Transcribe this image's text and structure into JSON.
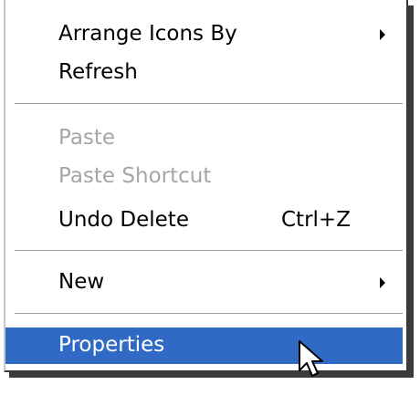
{
  "context_menu": {
    "items": [
      {
        "label": "Arrange Icons By",
        "has_submenu": true
      },
      {
        "label": "Refresh"
      },
      {
        "label": "Paste",
        "disabled": true
      },
      {
        "label": "Paste Shortcut",
        "disabled": true
      },
      {
        "label": "Undo Delete",
        "shortcut": "Ctrl+Z"
      },
      {
        "label": "New",
        "has_submenu": true
      },
      {
        "label": "Properties",
        "highlighted": true
      }
    ]
  },
  "colors": {
    "highlight": "#316ac5",
    "disabled_text": "#a6a6a6",
    "separator": "#9c9c9c"
  },
  "cursor": {
    "icon": "arrow-pointer-icon"
  }
}
